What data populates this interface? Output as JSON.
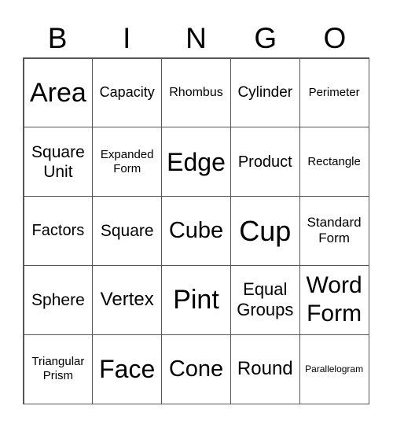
{
  "header": [
    "B",
    "I",
    "N",
    "G",
    "O"
  ],
  "cells": [
    [
      "Area",
      "Capacity",
      "Rhombus",
      "Cylinder",
      "Perimeter"
    ],
    [
      "Square Unit",
      "Expanded Form",
      "Edge",
      "Product",
      "Rectangle"
    ],
    [
      "Factors",
      "Square",
      "Cube",
      "Cup",
      "Standard Form"
    ],
    [
      "Sphere",
      "Vertex",
      "Pint",
      "Equal Groups",
      "Word Form"
    ],
    [
      "Triangular Prism",
      "Face",
      "Cone",
      "Round",
      "Parallelogram"
    ]
  ]
}
